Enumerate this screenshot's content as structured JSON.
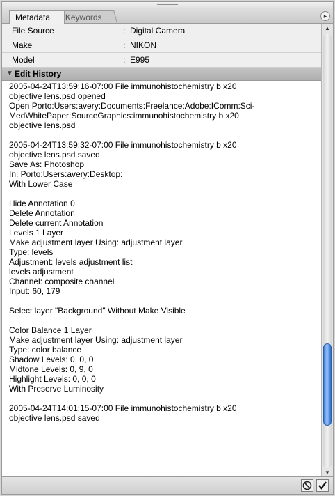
{
  "tabs": [
    {
      "label": "Metadata",
      "active": true
    },
    {
      "label": "Keywords",
      "active": false
    }
  ],
  "metadata_rows": [
    {
      "key": "File Source",
      "value": "Digital Camera"
    },
    {
      "key": "Make",
      "value": "NIKON"
    },
    {
      "key": "Model",
      "value": "E995"
    }
  ],
  "edit_history": {
    "title": "Edit History",
    "entries": [
      [
        "2005-04-24T13:59:16-07:00 File immunohistochemistry b x20",
        "objective lens.psd opened",
        "Open Porto:Users:avery:Documents:Freelance:Adobe:IComm:Sci-",
        "MedWhitePaper:SourceGraphics:immunohistochemistry b x20",
        "objective lens.psd"
      ],
      [
        "2005-04-24T13:59:32-07:00 File immunohistochemistry b x20",
        "objective lens.psd saved",
        "Save As: Photoshop",
        "In: Porto:Users:avery:Desktop:",
        "With Lower Case"
      ],
      [
        "Hide Annotation 0",
        "Delete Annotation",
        "Delete current Annotation",
        "Levels 1 Layer",
        "Make adjustment layer Using: adjustment layer",
        "Type: levels",
        "Adjustment: levels adjustment list",
        "levels adjustment",
        "Channel: composite channel",
        "Input: 60, 179"
      ],
      [
        "Select layer \"Background\" Without Make Visible"
      ],
      [
        "Color Balance 1 Layer",
        "Make adjustment layer Using: adjustment layer",
        "Type: color balance",
        "Shadow Levels: 0, 0, 0",
        "Midtone Levels: 0, 9, 0",
        "Highlight Levels: 0, 0, 0",
        "With Preserve Luminosity"
      ],
      [
        "2005-04-24T14:01:15-07:00 File immunohistochemistry b x20",
        "objective lens.psd saved"
      ]
    ]
  },
  "separator": ":",
  "scroll_position": 0.88,
  "icons": {
    "panel_menu": "circle-arrow-icon",
    "collapse": "triangle-down-icon",
    "cancel": "cancel-icon",
    "apply": "checkmark-icon"
  },
  "colors": {
    "scroll_thumb": "#4a8ae0",
    "header_bg": "#b8b8b8"
  }
}
